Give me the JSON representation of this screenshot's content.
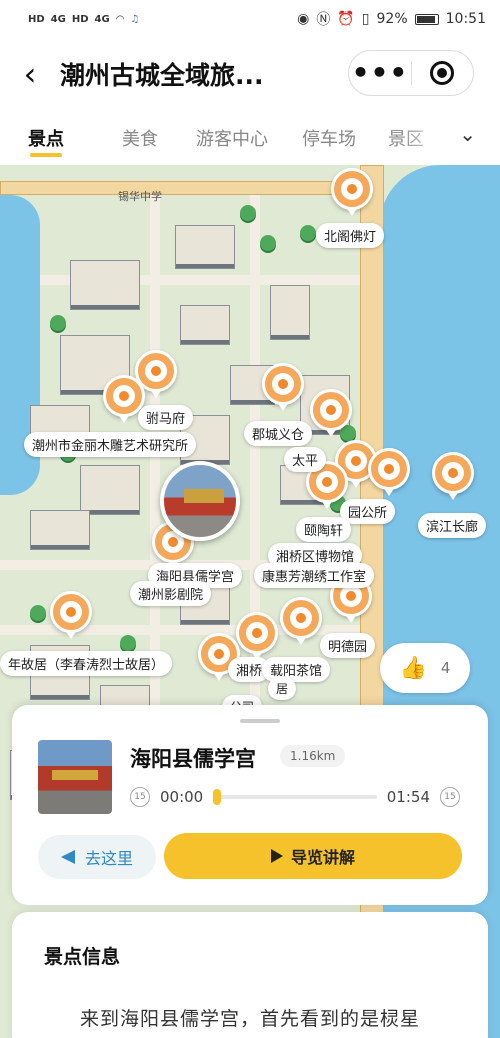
{
  "status": {
    "left_labels": [
      "HD",
      "4G",
      "HD",
      "4G"
    ],
    "battery": "92%",
    "time": "10:51"
  },
  "header": {
    "back_glyph": "‹",
    "title": "潮州古城全域旅..."
  },
  "tabs": [
    {
      "label": "景点",
      "active": true
    },
    {
      "label": "美食",
      "active": false
    },
    {
      "label": "游客中心",
      "active": false
    },
    {
      "label": "停车场",
      "active": false
    },
    {
      "label": "景区",
      "active": false
    }
  ],
  "map": {
    "labels": {
      "beige_fodeng": "北阁佛灯",
      "fuma_fu": "驸马府",
      "jinli_muxiao": "潮州市金丽木雕艺术研究所",
      "juncheng_yicang": "郡城义仓",
      "taiping": "太平",
      "yaogong_suo": "园公所",
      "binjiang_changlang": "滨江长廊",
      "yitao_xuan": "颐陶轩",
      "xiangqiao_bowuguan": "湘桥区博物馆",
      "haiyang_xuegong": "海阳县儒学宫",
      "kanghuifang": "康惠芳潮绣工作室",
      "chaozhou_juyuan": "潮州影剧院",
      "mingde_yuan": "明德园",
      "guju_li": "年故居（李春涛烈士故居）",
      "zaiyang_chaguan": "载阳茶馆",
      "xiangqiao_short": "湘桥",
      "guju2": "居",
      "gongsi": "公司",
      "school_top": "锡华中学"
    },
    "likes": "4"
  },
  "sheet": {
    "name": "海阳县儒学宫",
    "distance": "1.16km",
    "time_start": "00:00",
    "time_end": "01:54",
    "skip_back": "15",
    "skip_fwd": "15",
    "progress": 0,
    "go_label": "去这里",
    "guide_label": "导览讲解"
  },
  "info": {
    "title": "景点信息",
    "text": "来到海阳县儒学宫，首先看到的是棂星"
  },
  "colors": {
    "accent": "#f6c22b",
    "pin": "#f6a85a",
    "water": "#7cc3e8",
    "link": "#2f89c2"
  }
}
